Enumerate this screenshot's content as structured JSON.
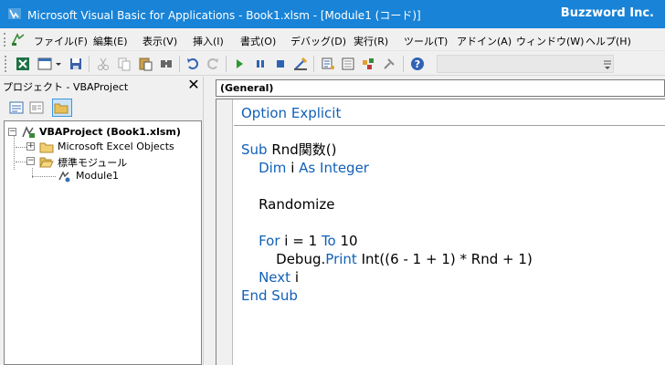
{
  "window": {
    "title": "Microsoft Visual Basic for Applications - Book1.xlsm - [Module1 (コード)]",
    "brand": "Buzzword Inc."
  },
  "menu": {
    "items": [
      "ファイル(F)",
      "編集(E)",
      "表示(V)",
      "挿入(I)",
      "書式(O)",
      "デバッグ(D)",
      "実行(R)",
      "ツール(T)",
      "アドイン(A)",
      "ウィンドウ(W)",
      "ヘルプ(H)"
    ]
  },
  "project": {
    "pane_title": "プロジェクト - VBAProject",
    "close_glyph": "✕",
    "tree": {
      "root": "VBAProject (Book1.xlsm)",
      "excel_objects": "Microsoft Excel Objects",
      "standard_modules": "標準モジュール",
      "module": "Module1"
    }
  },
  "code_window": {
    "object_combo": "(General)",
    "lines": [
      "Option Explicit",
      "",
      "Sub Rnd関数()",
      "    Dim i As Integer",
      "",
      "    Randomize",
      "",
      "    For i = 1 To 10",
      "        Debug.Print Int((6 - 1 + 1) * Rnd + 1)",
      "    Next i",
      "End Sub"
    ]
  },
  "colors": {
    "titlebar": "#1883d7",
    "keyword": "#1060b8"
  }
}
